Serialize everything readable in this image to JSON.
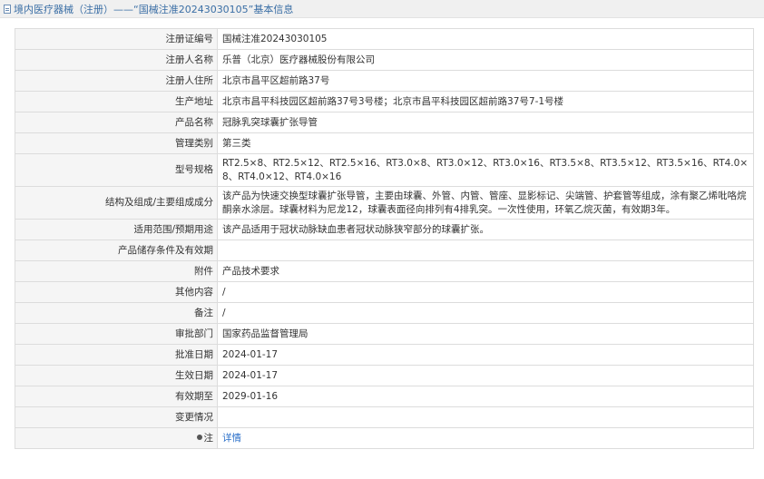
{
  "header": {
    "icon": "document-icon",
    "title": "境内医疗器械（注册）——“国械注准20243030105”基本信息"
  },
  "rows": [
    {
      "label": "注册证编号",
      "value": "国械注准20243030105"
    },
    {
      "label": "注册人名称",
      "value": "乐普（北京）医疗器械股份有限公司"
    },
    {
      "label": "注册人住所",
      "value": "北京市昌平区超前路37号"
    },
    {
      "label": "生产地址",
      "value": "北京市昌平科技园区超前路37号3号楼；北京市昌平科技园区超前路37号7-1号楼"
    },
    {
      "label": "产品名称",
      "value": "冠脉乳突球囊扩张导管"
    },
    {
      "label": "管理类别",
      "value": "第三类"
    },
    {
      "label": "型号规格",
      "value": "RT2.5×8、RT2.5×12、RT2.5×16、RT3.0×8、RT3.0×12、RT3.0×16、RT3.5×8、RT3.5×12、RT3.5×16、RT4.0×8、RT4.0×12、RT4.0×16"
    },
    {
      "label": "结构及组成/主要组成成分",
      "value": "该产品为快速交换型球囊扩张导管，主要由球囊、外管、内管、管座、显影标记、尖端管、护套管等组成，涂有聚乙烯吡咯烷酮亲水涂层。球囊材料为尼龙12，球囊表面径向排列有4排乳突。一次性使用，环氧乙烷灭菌，有效期3年。"
    },
    {
      "label": "适用范围/预期用途",
      "value": "该产品适用于冠状动脉缺血患者冠状动脉狭窄部分的球囊扩张。"
    },
    {
      "label": "产品储存条件及有效期",
      "value": ""
    },
    {
      "label": "附件",
      "value": "产品技术要求"
    },
    {
      "label": "其他内容",
      "value": "/"
    },
    {
      "label": "备注",
      "value": "/"
    },
    {
      "label": "审批部门",
      "value": "国家药品监督管理局"
    },
    {
      "label": "批准日期",
      "value": "2024-01-17"
    },
    {
      "label": "生效日期",
      "value": "2024-01-17"
    },
    {
      "label": "有效期至",
      "value": "2029-01-16"
    },
    {
      "label": "变更情况",
      "value": ""
    }
  ],
  "note": {
    "icon": "pin-icon",
    "label": "注",
    "link": "详情"
  }
}
